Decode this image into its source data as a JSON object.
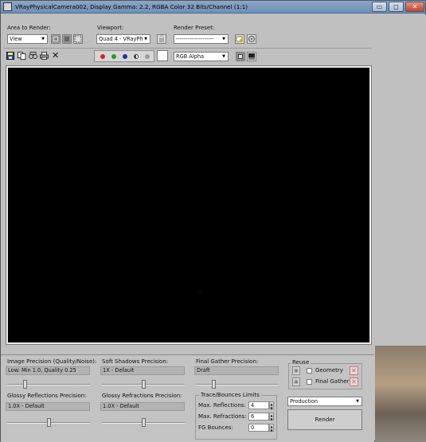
{
  "window": {
    "title": "VRayPhysicalCamera002, Display Gamma: 2.2, RGBA Color 32 Bits/Channel (1:1)",
    "controls": {
      "minimize": "▭",
      "maximize": "◻",
      "close": "✕"
    }
  },
  "toolbar": {
    "area_label": "Area to Render:",
    "area_value": "View",
    "viewport_label": "Viewport:",
    "viewport_value": "Quad 4 - VRayPh",
    "preset_label": "Render Preset:",
    "preset_value": "--------------------",
    "channel_value": "RGB Alpha",
    "channel_colors": {
      "red": "#e02020",
      "green": "#20a020",
      "blue": "#2030b0",
      "alpha": "#404040",
      "mono": "#9a9a9a"
    },
    "swatch_color": "#ffffff"
  },
  "viewport": {
    "background": "#000000"
  },
  "bottom": {
    "image_precision_label": "Image Precision (Quality/Noise):",
    "image_precision_value": "Low: Min 1.0, Quality 0.25",
    "image_precision_level": 0.2,
    "soft_shadows_label": "Soft Shadows Precision:",
    "soft_shadows_value": "1X - Default",
    "soft_shadows_level": 0.5,
    "final_gather_label": "Final Gather Precision:",
    "final_gather_value": "Draft",
    "final_gather_level": 0.2,
    "glossy_reflections_label": "Glossy Reflections Precision:",
    "glossy_reflections_value": "1.0X - Default",
    "glossy_reflections_level": 0.5,
    "glossy_refractions_label": "Glossy Refractions Precision:",
    "glossy_refractions_value": "1.0X - Default",
    "glossy_refractions_level": 0.5,
    "reuse": {
      "title": "Reuse",
      "geometry_label": "Geometry",
      "final_gather_label": "Final Gather"
    },
    "trace": {
      "title": "Trace/Bounces Limits",
      "max_reflections_label": "Max. Reflections:",
      "max_reflections_value": "4",
      "max_refractions_label": "Max. Refractions:",
      "max_refractions_value": "6",
      "fg_bounces_label": "FG Bounces:",
      "fg_bounces_value": "0"
    },
    "mode_value": "Production",
    "render_label": "Render"
  }
}
